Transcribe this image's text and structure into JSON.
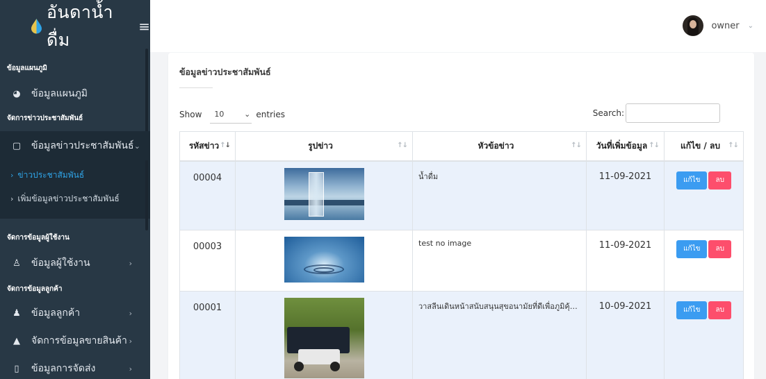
{
  "brand": {
    "title": "อันดาน้ำดื่ม",
    "menu_icon": "hamburger-icon",
    "logo_icon": "water-drop-icon",
    "color": "#2fa4e7"
  },
  "sidebar": {
    "sections": [
      {
        "label": "ข้อมูลแผนภูมิ"
      },
      {
        "label": "จัดการข่าวประชาสัมพันธ์"
      },
      {
        "label": "จัดการข้อมูลผู้ใช้งาน"
      },
      {
        "label": "จัดการข้อมูลลูกค้า"
      }
    ],
    "items": [
      {
        "label": "ข้อมูลแผนภูมิ",
        "icon": "pie-chart-icon"
      },
      {
        "label": "ข้อมูลข่าวประชาสัมพันธ์",
        "icon": "file-icon"
      },
      {
        "label": "ข้อมูลผู้ใช้งาน",
        "icon": "user-icon"
      },
      {
        "label": "ข้อมูลลูกค้า",
        "icon": "users-icon"
      },
      {
        "label": "จัดการข้อมูลขายสินค้า",
        "icon": "shopping-bag-icon"
      },
      {
        "label": "ข้อมูลการจัดส่ง",
        "icon": "box-icon"
      }
    ],
    "sub_items": [
      {
        "label": "ข่าวประชาสัมพันธ์"
      },
      {
        "label": "เพิ่มข้อมูลข่าวประชาสัมพันธ์"
      }
    ]
  },
  "topbar": {
    "user_name": "owner"
  },
  "card": {
    "title": "ข้อมูลข่าวประชาสัมพันธ์",
    "show_label": "Show",
    "entries_value": "10",
    "entries_label": "entries",
    "search_label": "Search:",
    "search_value": ""
  },
  "table": {
    "columns": [
      "รหัสข่าว",
      "รูปข่าว",
      "หัวข้อข่าว",
      "วันที่เพิ่มข้อมูล",
      "แก้ไข / ลบ"
    ],
    "rows": [
      {
        "code": "00004",
        "image": "glass-of-water-photo",
        "headline": "น้ำดื่ม",
        "date": "11-09-2021",
        "edit": "แก้ไข",
        "delete": "ลบ"
      },
      {
        "code": "00003",
        "image": "water-drop-photo",
        "headline": "test no image",
        "date": "11-09-2021",
        "edit": "แก้ไข",
        "delete": "ลบ"
      },
      {
        "code": "00001",
        "image": "water-delivery-truck-photo",
        "headline": "วาสลีนเดินหน้าสนับสนุนสุขอนามัยที่ดีเพื่อภูมิคุ้มก...",
        "date": "10-09-2021",
        "edit": "แก้ไข",
        "delete": "ลบ"
      }
    ]
  }
}
